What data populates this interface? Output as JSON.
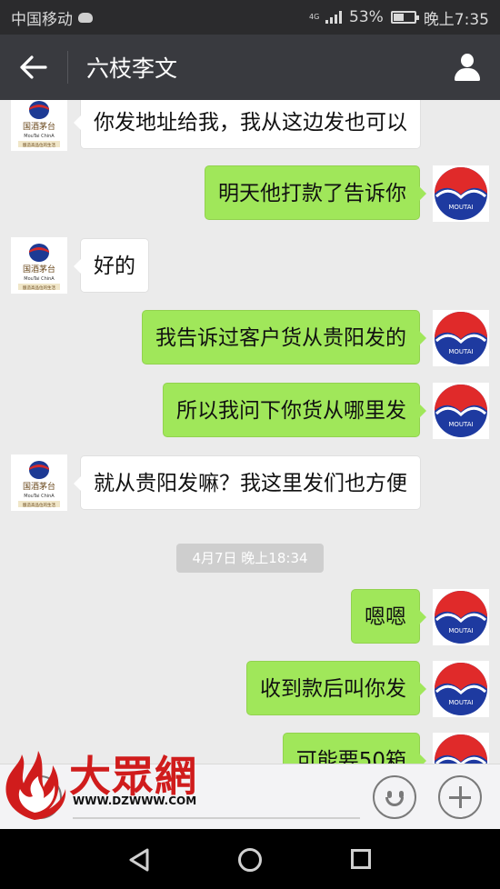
{
  "status_bar": {
    "carrier": "中国移动",
    "network": "4G",
    "battery_percent": "53%",
    "battery_level": 0.53,
    "time": "晚上7:35"
  },
  "header": {
    "title": "六枝李文",
    "back_icon": "arrow-left-icon",
    "profile_icon": "person-icon"
  },
  "contact_logo": {
    "brand": "国酒茅台",
    "sub": "MouTai ChinA",
    "tagline": "酿造高品位的生活"
  },
  "self_logo": {
    "text": "MOUTAI"
  },
  "messages": [
    {
      "side": "in",
      "text": "你发地址给我，我从这边发也可以"
    },
    {
      "side": "out",
      "text": "明天他打款了告诉你"
    },
    {
      "side": "in",
      "text": "好的"
    },
    {
      "side": "out",
      "text": "我告诉过客户货从贵阳发的"
    },
    {
      "side": "out",
      "text": "所以我问下你货从哪里发"
    },
    {
      "side": "in",
      "text": "就从贵阳发嘛？我这里发们也方便"
    },
    {
      "side": "out",
      "text": "嗯嗯"
    },
    {
      "side": "out",
      "text": "收到款后叫你发"
    },
    {
      "side": "out",
      "text": "可能要50箱"
    }
  ],
  "timestamp": "4月7日 晚上18:34",
  "input": {
    "value": "",
    "voice_icon": "voice-icon",
    "emoji_icon": "emoji-icon",
    "plus_icon": "plus-icon"
  },
  "watermark": {
    "brand": "大眾網",
    "url": "WWW.DZWWW.COM"
  },
  "nav": {
    "back_icon": "triangle-back-icon",
    "home_icon": "circle-home-icon",
    "recent_icon": "square-recent-icon"
  },
  "colors": {
    "outgoing_bubble": "#a0e75a",
    "incoming_bubble": "#ffffff",
    "title_bar": "#393a3f",
    "background": "#ebebeb",
    "watermark_red": "#d01c1c"
  }
}
